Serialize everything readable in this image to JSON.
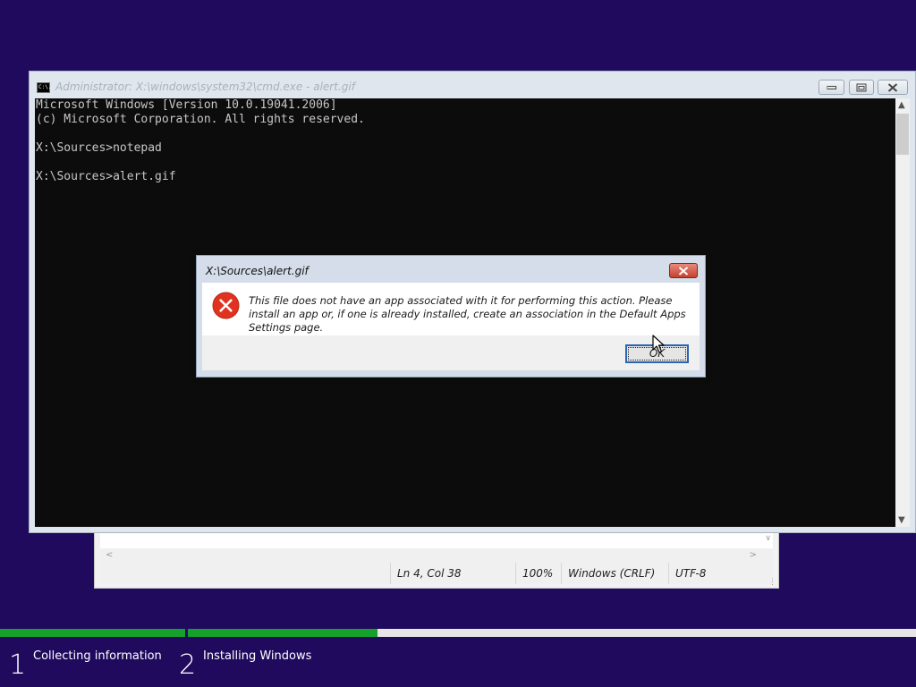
{
  "cmd_window": {
    "title": "Administrator: X:\\windows\\system32\\cmd.exe - alert.gif",
    "app_icon_text": "C:\\.",
    "console_lines": [
      "Microsoft Windows [Version 10.0.19041.2006]",
      "(c) Microsoft Corporation. All rights reserved.",
      "",
      "X:\\Sources>notepad",
      "",
      "X:\\Sources>alert.gif"
    ]
  },
  "dialog": {
    "title": "X:\\Sources\\alert.gif",
    "message": "This file does not have an app associated with it for performing this action. Please install an app or, if one is already installed, create an association in the Default Apps Settings page.",
    "ok_label": "OK",
    "icon": "error-icon"
  },
  "notepad": {
    "status": {
      "position": "Ln 4, Col 38",
      "zoom": "100%",
      "line_ending": "Windows (CRLF)",
      "encoding": "UTF-8"
    }
  },
  "setup": {
    "steps": [
      {
        "number": "1",
        "label": "Collecting information",
        "progress": 1.0
      },
      {
        "number": "2",
        "label": "Installing Windows",
        "progress": 0.26
      }
    ]
  },
  "colors": {
    "background": "#1f0a5e",
    "progress_fill": "#15a12b",
    "console_bg": "#0c0c0c",
    "console_text": "#c7c7c7"
  }
}
